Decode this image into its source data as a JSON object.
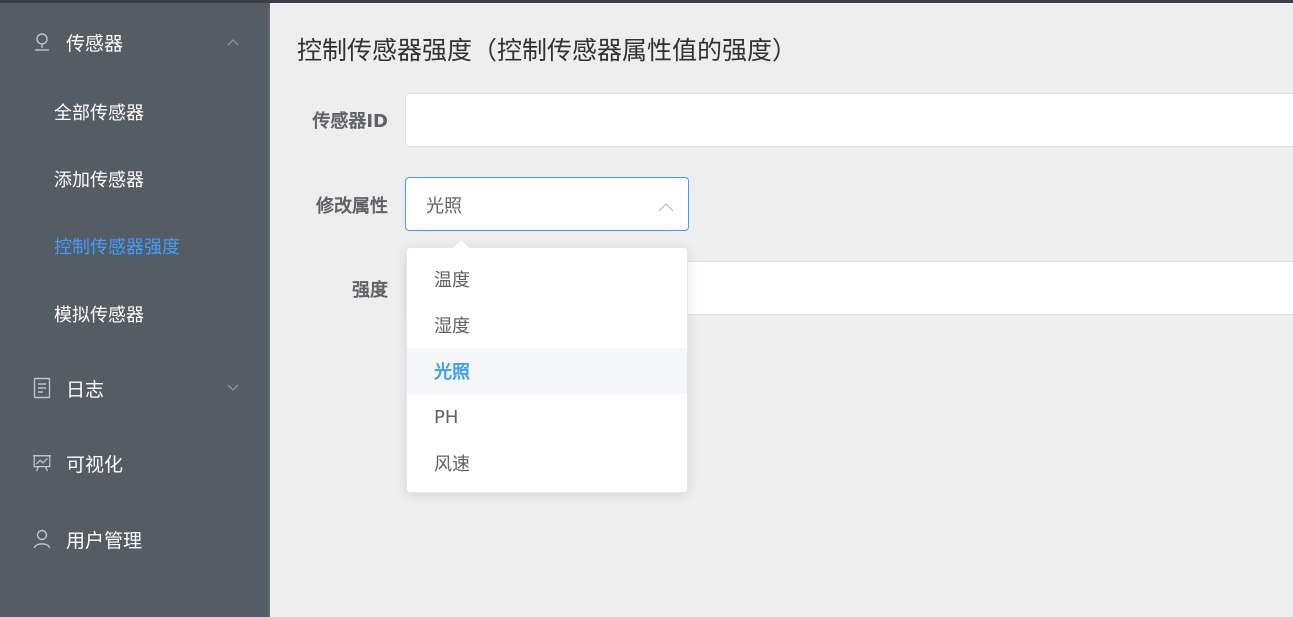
{
  "sidebar": {
    "menus": [
      {
        "label": "传感器",
        "icon": "sensor-icon",
        "expanded": true,
        "children": [
          {
            "label": "全部传感器"
          },
          {
            "label": "添加传感器"
          },
          {
            "label": "控制传感器强度",
            "active": true
          },
          {
            "label": "模拟传感器"
          }
        ]
      },
      {
        "label": "日志",
        "icon": "log-document-icon",
        "expanded": false
      },
      {
        "label": "可视化",
        "icon": "chart-board-icon"
      },
      {
        "label": "用户管理",
        "icon": "user-icon"
      }
    ]
  },
  "main": {
    "title": "控制传感器强度（控制传感器属性值的强度）",
    "form": {
      "sensor_id_label": "传感器ID",
      "sensor_id_value": "",
      "attribute_label": "修改属性",
      "attribute_value": "光照",
      "strength_label": "强度",
      "strength_value": ""
    },
    "dropdown": {
      "options": [
        "温度",
        "湿度",
        "光照",
        "PH",
        "风速"
      ],
      "selected": "光照"
    }
  },
  "colors": {
    "sidebar_bg": "#545c64",
    "accent": "#409eff",
    "main_bg": "#eeeeee"
  }
}
